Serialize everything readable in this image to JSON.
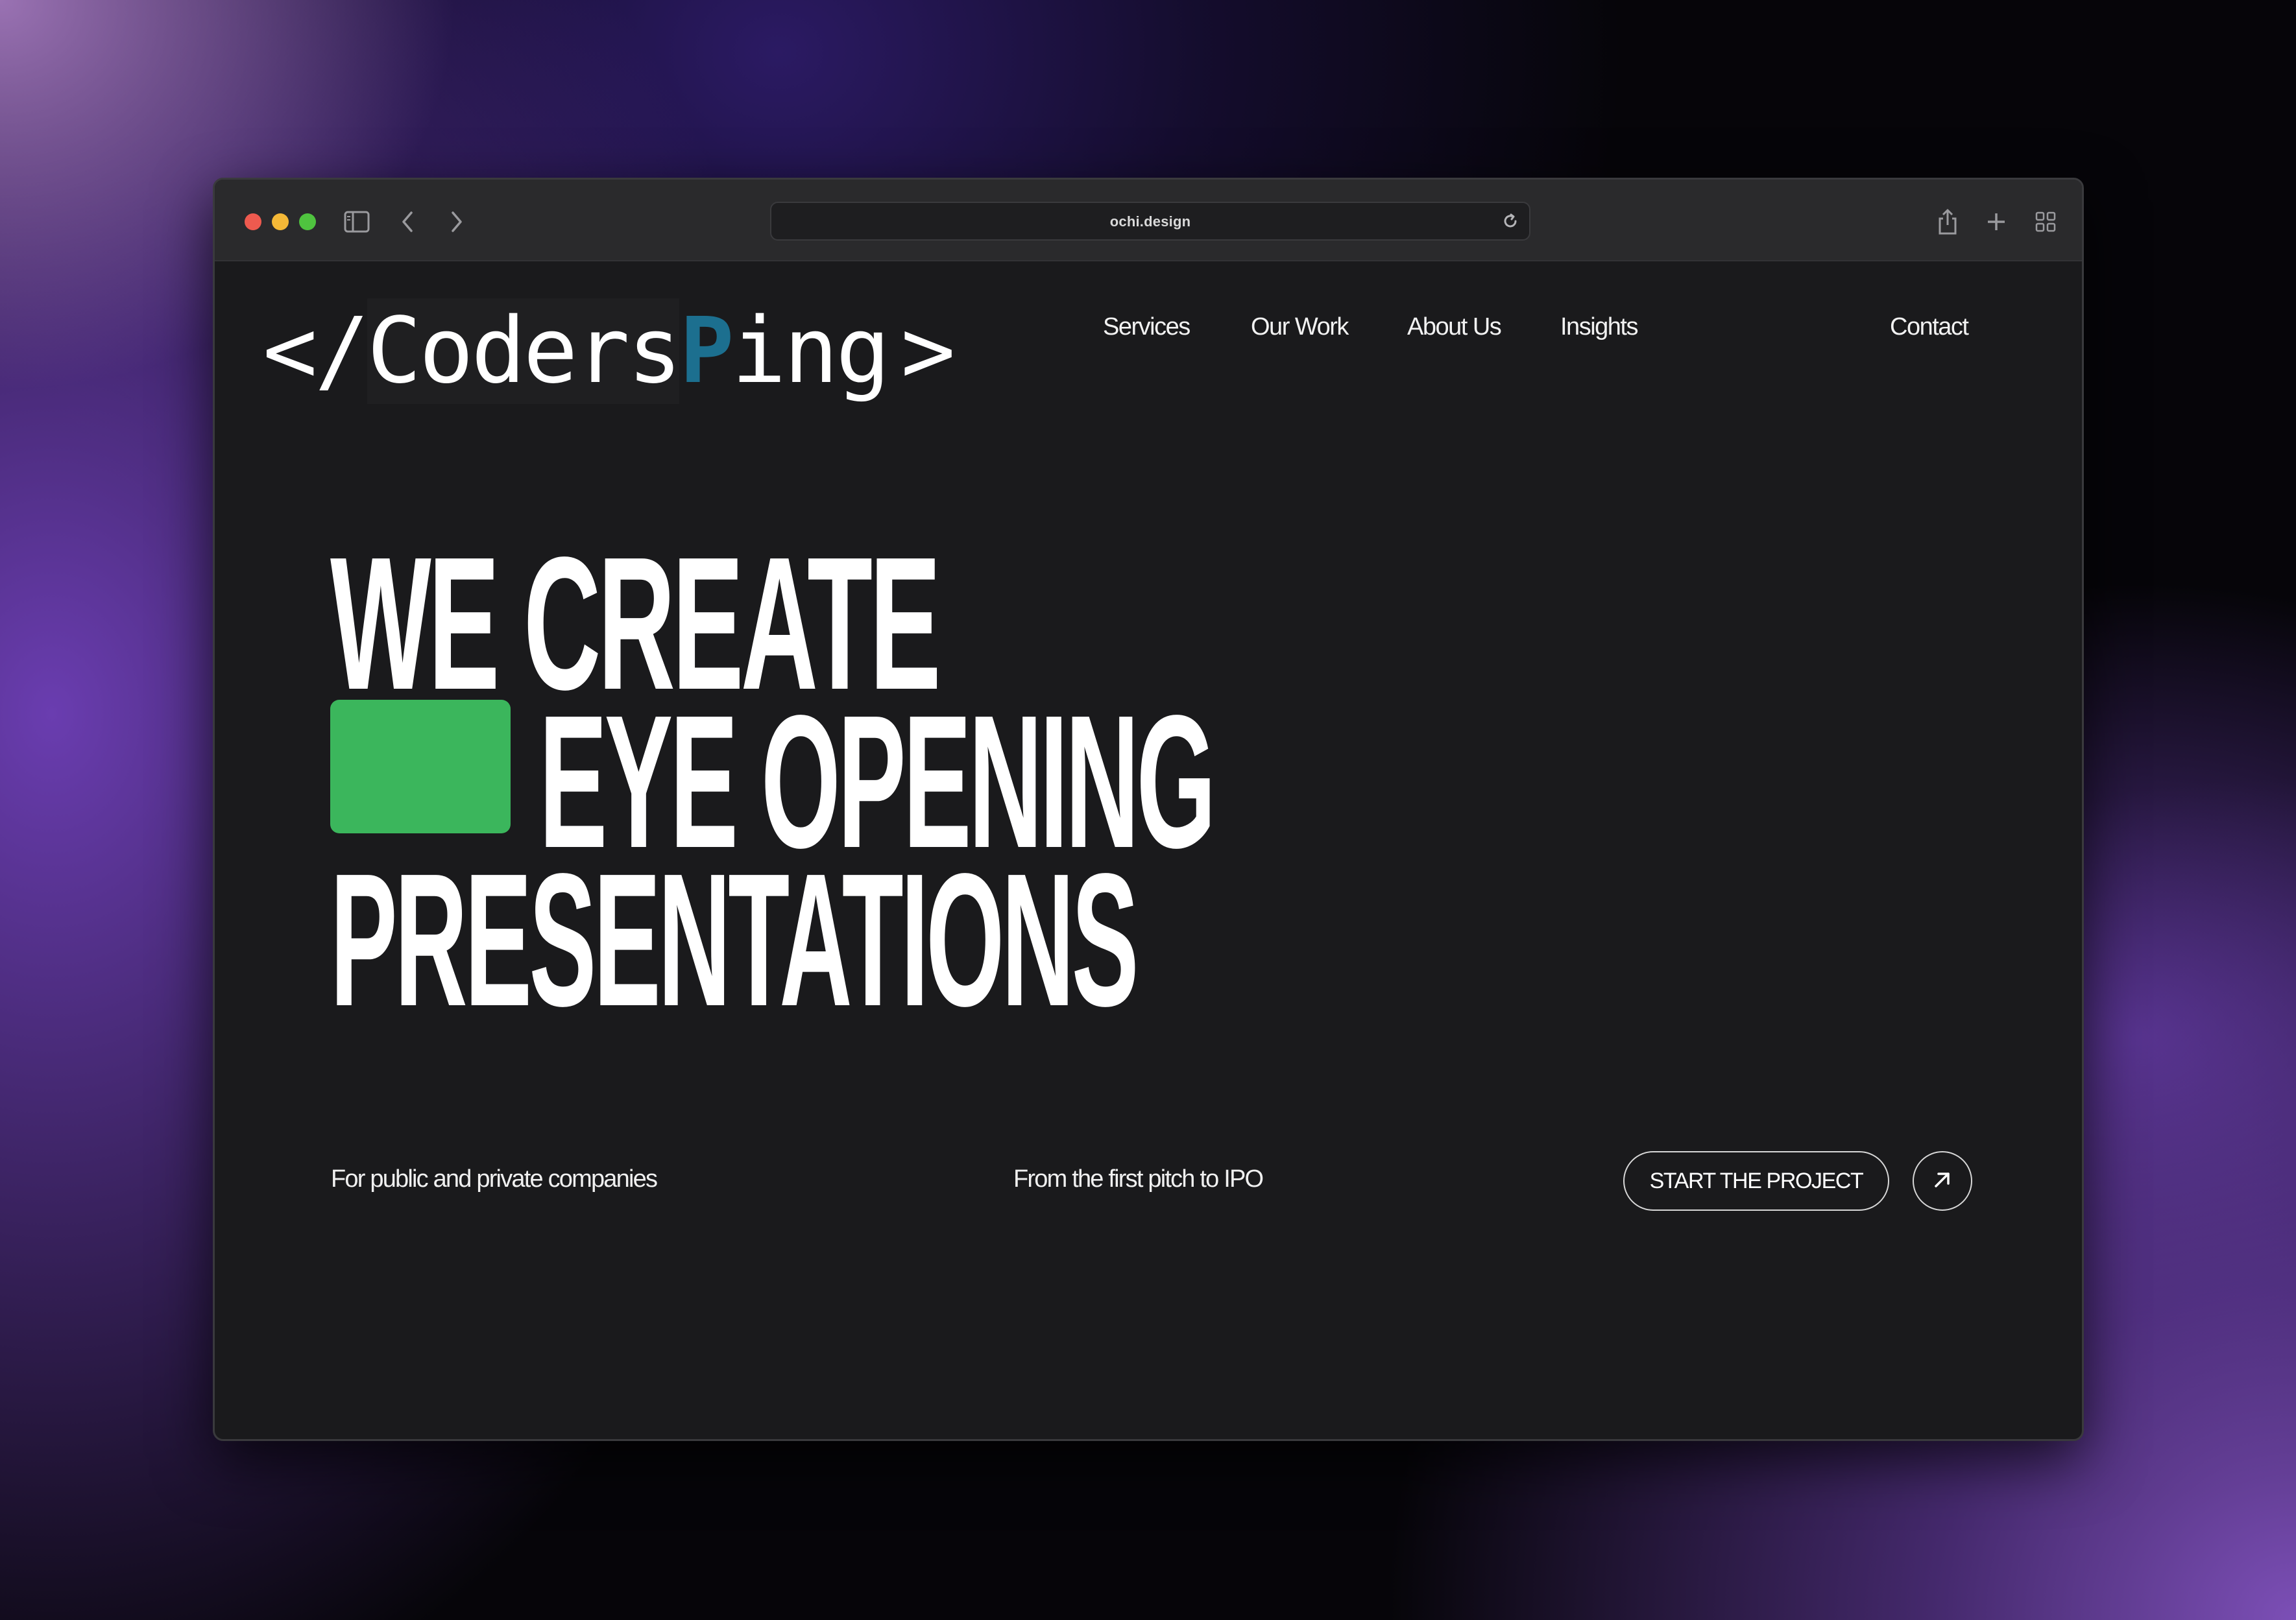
{
  "browser": {
    "url": "ochi.design",
    "icons": [
      "sidebar-icon",
      "back-icon",
      "forward-icon",
      "reload-icon",
      "share-icon",
      "new-tab-icon",
      "tab-overview-icon"
    ]
  },
  "logo": {
    "bracket_open": "</",
    "coders": "Coders",
    "p": "P",
    "ing": "ing",
    "bracket_close": ">",
    "accent_color": "#1c6f8f"
  },
  "nav": {
    "items": [
      {
        "label": "Services"
      },
      {
        "label": "Our Work"
      },
      {
        "label": "About Us"
      },
      {
        "label": "Insights"
      }
    ],
    "contact_label": "Contact"
  },
  "hero": {
    "line1": "WE CREATE",
    "line2": "EYE OPENING",
    "line3": "PRESENTATIONS",
    "block_color": "#3bb65c"
  },
  "footer_row": {
    "left_text": "For public and private companies",
    "middle_text": "From the first pitch to IPO",
    "cta_label": "START THE PROJECT",
    "cta_icon": "arrow-up-right-icon"
  }
}
